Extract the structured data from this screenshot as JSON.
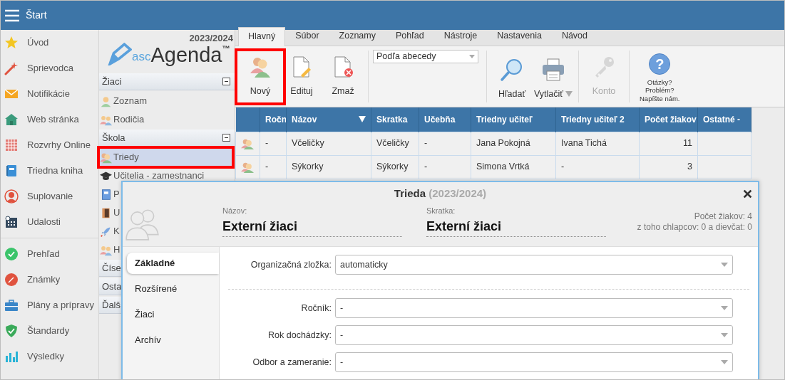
{
  "topbar": {
    "title": "Štart"
  },
  "main_menu": {
    "groups": [
      {
        "items": [
          {
            "label": "Úvod"
          },
          {
            "label": "Sprievodca"
          },
          {
            "label": "Notifikácie"
          },
          {
            "label": "Web stránka"
          },
          {
            "label": "Rozvrhy Online"
          },
          {
            "label": "Triedna kniha"
          },
          {
            "label": "Suplovanie"
          },
          {
            "label": "Udalosti"
          }
        ]
      },
      {
        "items": [
          {
            "label": "Prehľad"
          },
          {
            "label": "Známky"
          },
          {
            "label": "Plány a prípravy"
          },
          {
            "label": "Štandardy"
          },
          {
            "label": "Výsledky"
          }
        ]
      }
    ]
  },
  "agenda_panel": {
    "year": "2023/2024",
    "logo": {
      "prefix": "asc",
      "name": "Agenda",
      "mark": "™"
    },
    "sections": [
      {
        "title": "Žiaci",
        "expanded": true,
        "items": [
          {
            "label": "Zoznam",
            "selected": false,
            "highlighted": false
          },
          {
            "label": "Rodičia",
            "selected": false,
            "highlighted": false
          }
        ]
      },
      {
        "title": "Škola",
        "expanded": true,
        "items": [
          {
            "label": "Triedy",
            "selected": true,
            "highlighted": true
          },
          {
            "label": "Učitelia - zamestnanci",
            "selected": false,
            "highlighted": false
          },
          {
            "label": "P",
            "selected": false,
            "highlighted": false
          },
          {
            "label": "U",
            "selected": false,
            "highlighted": false
          },
          {
            "label": "K",
            "selected": false,
            "highlighted": false
          },
          {
            "label": "H",
            "selected": false,
            "highlighted": false
          }
        ]
      },
      {
        "title": "Číse"
      },
      {
        "title": "Osta"
      },
      {
        "title": "Ďalš"
      }
    ]
  },
  "ribbon": {
    "tabs": [
      {
        "label": "Hlavný",
        "selected": true
      },
      {
        "label": "Súbor",
        "selected": false
      },
      {
        "label": "Zoznamy",
        "selected": false
      },
      {
        "label": "Pohľad",
        "selected": false
      },
      {
        "label": "Nástroje",
        "selected": false
      },
      {
        "label": "Nastavenia",
        "selected": false
      },
      {
        "label": "Návod",
        "selected": false
      }
    ],
    "groups": [
      {
        "items": [
          {
            "kind": "button",
            "label": "Nový",
            "highlighted": true,
            "disabled": false
          },
          {
            "kind": "button",
            "label": "Edituj",
            "highlighted": false,
            "disabled": false
          },
          {
            "kind": "button",
            "label": "Zmaž",
            "highlighted": false,
            "disabled": false
          }
        ]
      },
      {
        "items": [
          {
            "kind": "dropdown",
            "value": "Podľa abecedy"
          }
        ]
      },
      {
        "items": [
          {
            "kind": "button",
            "label": "Hľadať",
            "highlighted": false,
            "disabled": false
          },
          {
            "kind": "split",
            "label": "Vytlačiť",
            "highlighted": false,
            "disabled": false
          }
        ]
      },
      {
        "items": [
          {
            "kind": "button",
            "label": "Konto",
            "highlighted": false,
            "disabled": true
          }
        ]
      },
      {
        "items": [
          {
            "kind": "help",
            "symbol": "?",
            "lines": [
              "Otázky?",
              "Problém?",
              "Napíšte nám."
            ]
          }
        ]
      }
    ]
  },
  "table": {
    "columns": [
      {
        "label": "Ročn"
      },
      {
        "label": "Názov",
        "sorted": true
      },
      {
        "label": "Skratka"
      },
      {
        "label": "Učebňa"
      },
      {
        "label": "Triedny učiteľ"
      },
      {
        "label": "Triedny učiteľ 2"
      },
      {
        "label": "Počet žiakov"
      },
      {
        "label": "Ostatné -"
      }
    ],
    "rows": [
      {
        "cells": [
          "-",
          "Včeličky",
          "Včeličky",
          "-",
          "Jana Pokojná",
          "Ivana Tichá",
          "11",
          ""
        ]
      },
      {
        "cells": [
          "-",
          "Sýkorky",
          "Sýkorky",
          "-",
          "Simona Vrtká",
          "-",
          "3",
          ""
        ]
      }
    ]
  },
  "dialog": {
    "title": "Trieda",
    "subtitle": "(2023/2024)",
    "fields": [
      {
        "label": "Názov:",
        "value": "Externí žiaci"
      },
      {
        "label": "Skratka:",
        "value": "Externí žiaci"
      }
    ],
    "summary": [
      "Počet žiakov: 4",
      "z toho chlapcov: 0 a dievčat: 0"
    ],
    "tabs": [
      {
        "label": "Základné",
        "selected": true
      },
      {
        "label": "Rozšírené",
        "selected": false
      },
      {
        "label": "Žiaci",
        "selected": false
      },
      {
        "label": "Archív",
        "selected": false
      }
    ],
    "form": [
      {
        "kind": "select",
        "label": "Organizačná zložka:",
        "value": "automaticky"
      },
      {
        "kind": "divider"
      },
      {
        "kind": "select",
        "label": "Ročník:",
        "value": "-"
      },
      {
        "kind": "select",
        "label": "Rok dochádzky:",
        "value": "-"
      },
      {
        "kind": "select",
        "label": "Odbor a zameranie:",
        "value": "-"
      }
    ]
  }
}
